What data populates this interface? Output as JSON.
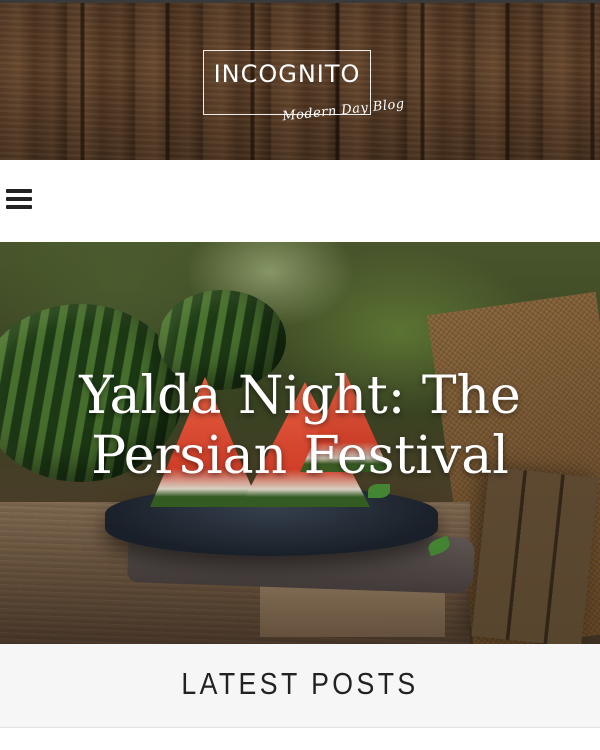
{
  "header": {
    "logo_title": "INCOGNITO",
    "logo_tagline": "Modern Day Blog"
  },
  "nav": {
    "menu_icon": "hamburger-menu-icon"
  },
  "hero": {
    "title": "Yalda Night: The Persian Festival",
    "image": "watermelon-slices-photo"
  },
  "latest": {
    "heading": "LATEST POSTS"
  }
}
